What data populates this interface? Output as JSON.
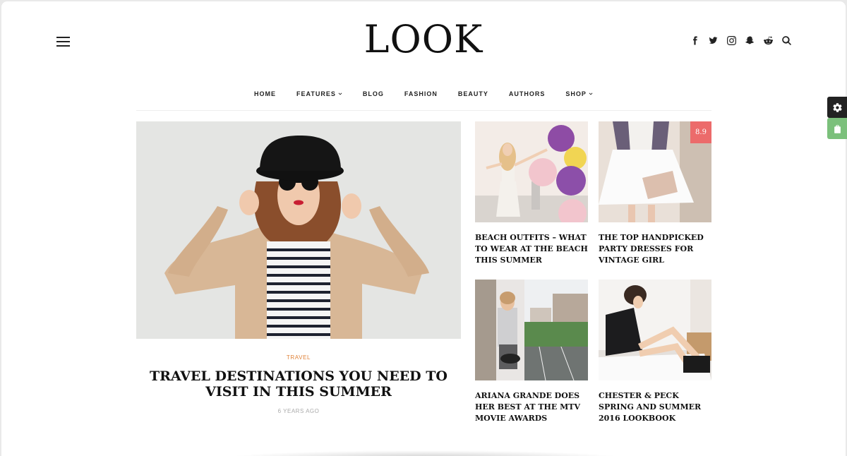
{
  "site": {
    "logo": "LOOK"
  },
  "header": {
    "social_icons": [
      "facebook-icon",
      "twitter-icon",
      "instagram-icon",
      "snapchat-icon",
      "reddit-icon",
      "search-icon"
    ]
  },
  "nav": {
    "items": [
      {
        "label": "HOME",
        "dropdown": false
      },
      {
        "label": "FEATURES",
        "dropdown": true
      },
      {
        "label": "BLOG",
        "dropdown": false
      },
      {
        "label": "FASHION",
        "dropdown": false
      },
      {
        "label": "BEAUTY",
        "dropdown": false
      },
      {
        "label": "AUTHORS",
        "dropdown": false
      },
      {
        "label": "SHOP",
        "dropdown": true
      }
    ]
  },
  "featured": {
    "category": "TRAVEL",
    "title": "TRAVEL DESTINATIONS YOU NEED TO VISIT IN THIS SUMMER",
    "meta": "6 YEARS AGO"
  },
  "cards": [
    {
      "title": "BEACH OUTFITS – WHAT TO WEAR AT THE BEACH THIS SUMMER"
    },
    {
      "title": "THE TOP HANDPICKED PARTY DRESSES FOR VINTAGE GIRL",
      "score": "8.9"
    },
    {
      "title": "ARIANA GRANDE DOES HER BEST AT THE MTV MOVIE AWARDS"
    },
    {
      "title": "CHESTER & PECK SPRING AND SUMMER 2016 LOOKBOOK"
    }
  ],
  "colors": {
    "category": "#e0833a",
    "score_badge": "#ec6b6b",
    "shop_button": "#7bc07b",
    "settings_button": "#222222"
  }
}
